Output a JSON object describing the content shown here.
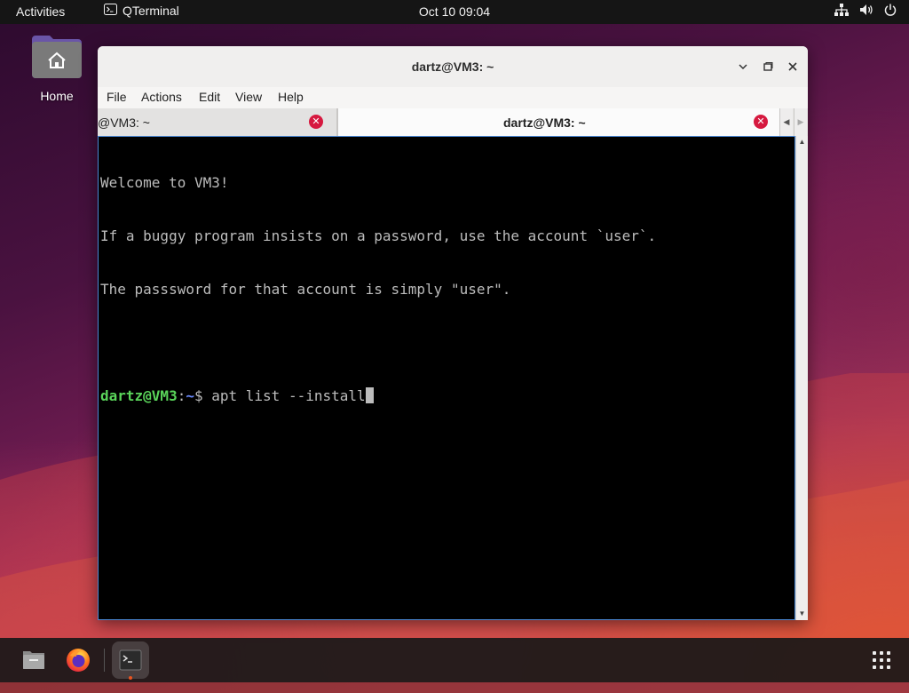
{
  "topbar": {
    "activities": "Activities",
    "app_name": "QTerminal",
    "clock": "Oct 10  09:04",
    "tray_icons": [
      "network-icon",
      "volume-icon",
      "power-icon"
    ]
  },
  "desktop": {
    "home_label": "Home"
  },
  "window": {
    "title": "dartz@VM3: ~",
    "controls": [
      "minimize-icon",
      "maximize-icon",
      "close-icon"
    ]
  },
  "menu": {
    "file": "File",
    "actions": "Actions",
    "edit": "Edit",
    "view": "View",
    "help": "Help"
  },
  "tabs": [
    {
      "label": "@VM3: ~",
      "active": false
    },
    {
      "label": "dartz@VM3: ~",
      "active": true
    }
  ],
  "terminal": {
    "lines": [
      "Welcome to VM3!",
      "If a buggy program insists on a password, use the account `user`.",
      "The passsword for that account is simply \"user\".",
      ""
    ],
    "prompt_user": "dartz@VM3",
    "prompt_sep": ":",
    "prompt_path": "~",
    "prompt_symbol": "$ ",
    "command": "apt list --install"
  },
  "dock": {
    "items": [
      "files-icon",
      "firefox-icon",
      "terminal-icon"
    ],
    "show_apps": "app-grid-icon"
  },
  "colors": {
    "topbar": "#151515",
    "prompt_user": "#5ad45a",
    "prompt_path": "#6b8bff",
    "tab_close": "#d6193f",
    "terminal_bg": "#000000"
  }
}
